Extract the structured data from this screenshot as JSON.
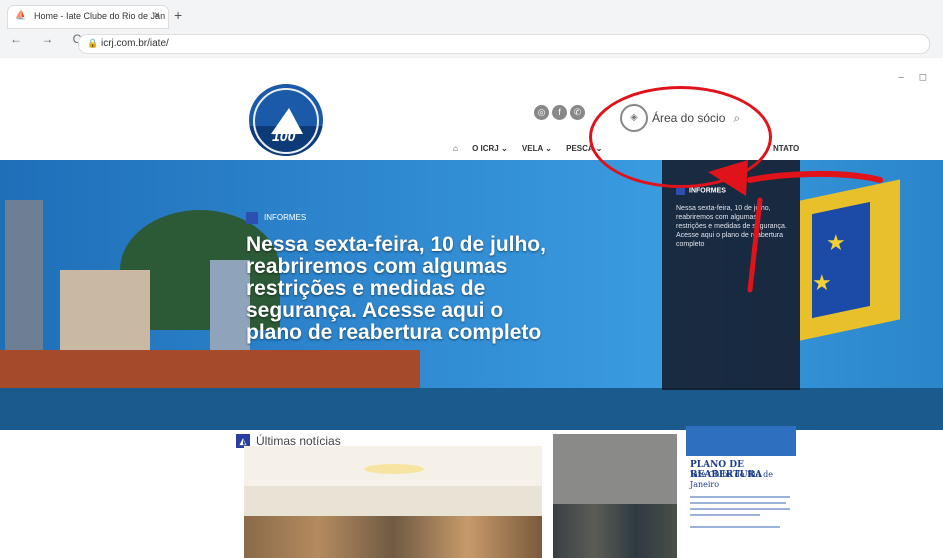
{
  "browser": {
    "tab_title": "Home - Iate Clube do Rio de Jan",
    "url": "icrj.com.br/iate/",
    "new_tab": "+",
    "close": "×",
    "nav_buttons": "← → C"
  },
  "header": {
    "logo_year": "100",
    "area_label": "Área do sócio",
    "nav": [
      "⌂",
      "O ICRJ ⌄",
      "VELA ⌄",
      "PESCA ⌄"
    ],
    "nav_extra": "NTATO"
  },
  "hero": {
    "tag": "INFORMES",
    "headline": "Nessa sexta-feira, 10 de julho, reabriremos com algumas restrições e medidas de segurança. Acesse aqui o plano de reabertura completo",
    "side_tag": "INFORMES",
    "side_text": "Nessa sexta-feira, 10 de julho, reabriremos com algumas restrições e medidas de segurança. Acesse aqui o plano de reabertura completo"
  },
  "news": {
    "heading": "Últimas notícias",
    "card3_title": "PLANO DE REABERTURA",
    "card3_subtitle": "Iate Clube do Rio de Janeiro"
  },
  "colors": {
    "accent": "#2c4fb0",
    "annotation": "#e0121a"
  }
}
